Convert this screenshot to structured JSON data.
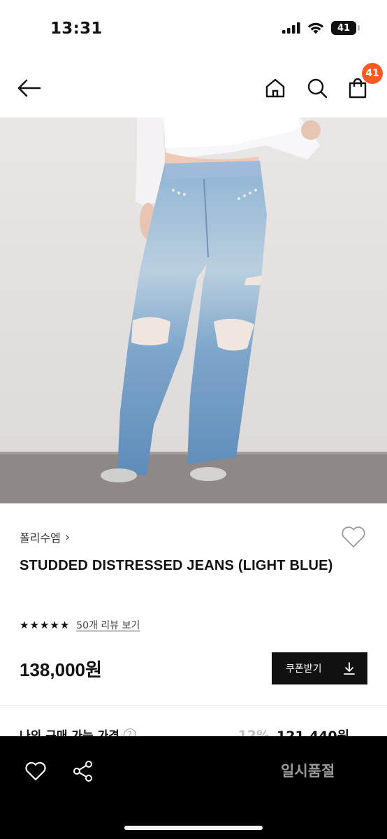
{
  "status_bar": {
    "time": "13:31",
    "battery": "41",
    "icons": [
      "signal-icon",
      "wifi-icon",
      "battery-icon"
    ]
  },
  "header": {
    "icons": [
      "back-arrow-icon",
      "home-icon",
      "search-icon",
      "cart-icon"
    ],
    "cart_badge": "41",
    "badge_color": "#ff5a1f"
  },
  "product": {
    "image_alt": "model-wearing-light-blue-distressed-jeans",
    "brand": "폴리수엠",
    "brand_chevron": "›",
    "title": "STUDDED DISTRESSED JEANS (LIGHT BLUE)",
    "rating_stars": 5,
    "review_link": "50개 리뷰 보기",
    "price": "138,000원",
    "coupon_label": "쿠폰받기"
  },
  "my_purchase": {
    "label": "나의 구매 가능 가격",
    "help": "?",
    "discount": "12%",
    "price": "121,440원",
    "chevron": "⌄"
  },
  "bottom_bar": {
    "icons": [
      "heart-outline-icon",
      "share-icon"
    ],
    "status": "일시품절"
  }
}
